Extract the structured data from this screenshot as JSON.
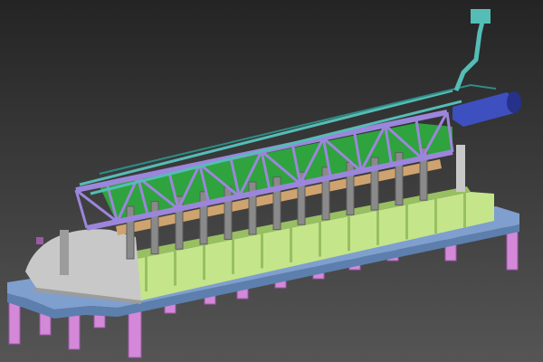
{
  "scene": {
    "colors": {
      "background_top": "#242424",
      "background_bottom": "#555555",
      "platform_blue": "#7f9fcf",
      "platform_blue_dark": "#5d7fae",
      "legs_pink": "#d488d8",
      "legs_pink_dark": "#9a5aa4",
      "tank_green": "#c4e58a",
      "tank_green_dark": "#98bf62",
      "hood_gray": "#c8c8c8",
      "hood_gray_dark": "#9c9c9c",
      "inner_green": "#2fa33d",
      "truss_purple": "#9c86dc",
      "truss_purple_dark": "#6e5bb0",
      "beam_tan": "#cfa36f",
      "column_gray": "#8a8a8a",
      "column_gray_dark": "#5f5f5f",
      "duct_blue": "#3e4fc0",
      "duct_blue_dark": "#26318a",
      "pipe_teal": "#55bdb6",
      "pipe_teal_dark": "#2f8c86"
    }
  }
}
